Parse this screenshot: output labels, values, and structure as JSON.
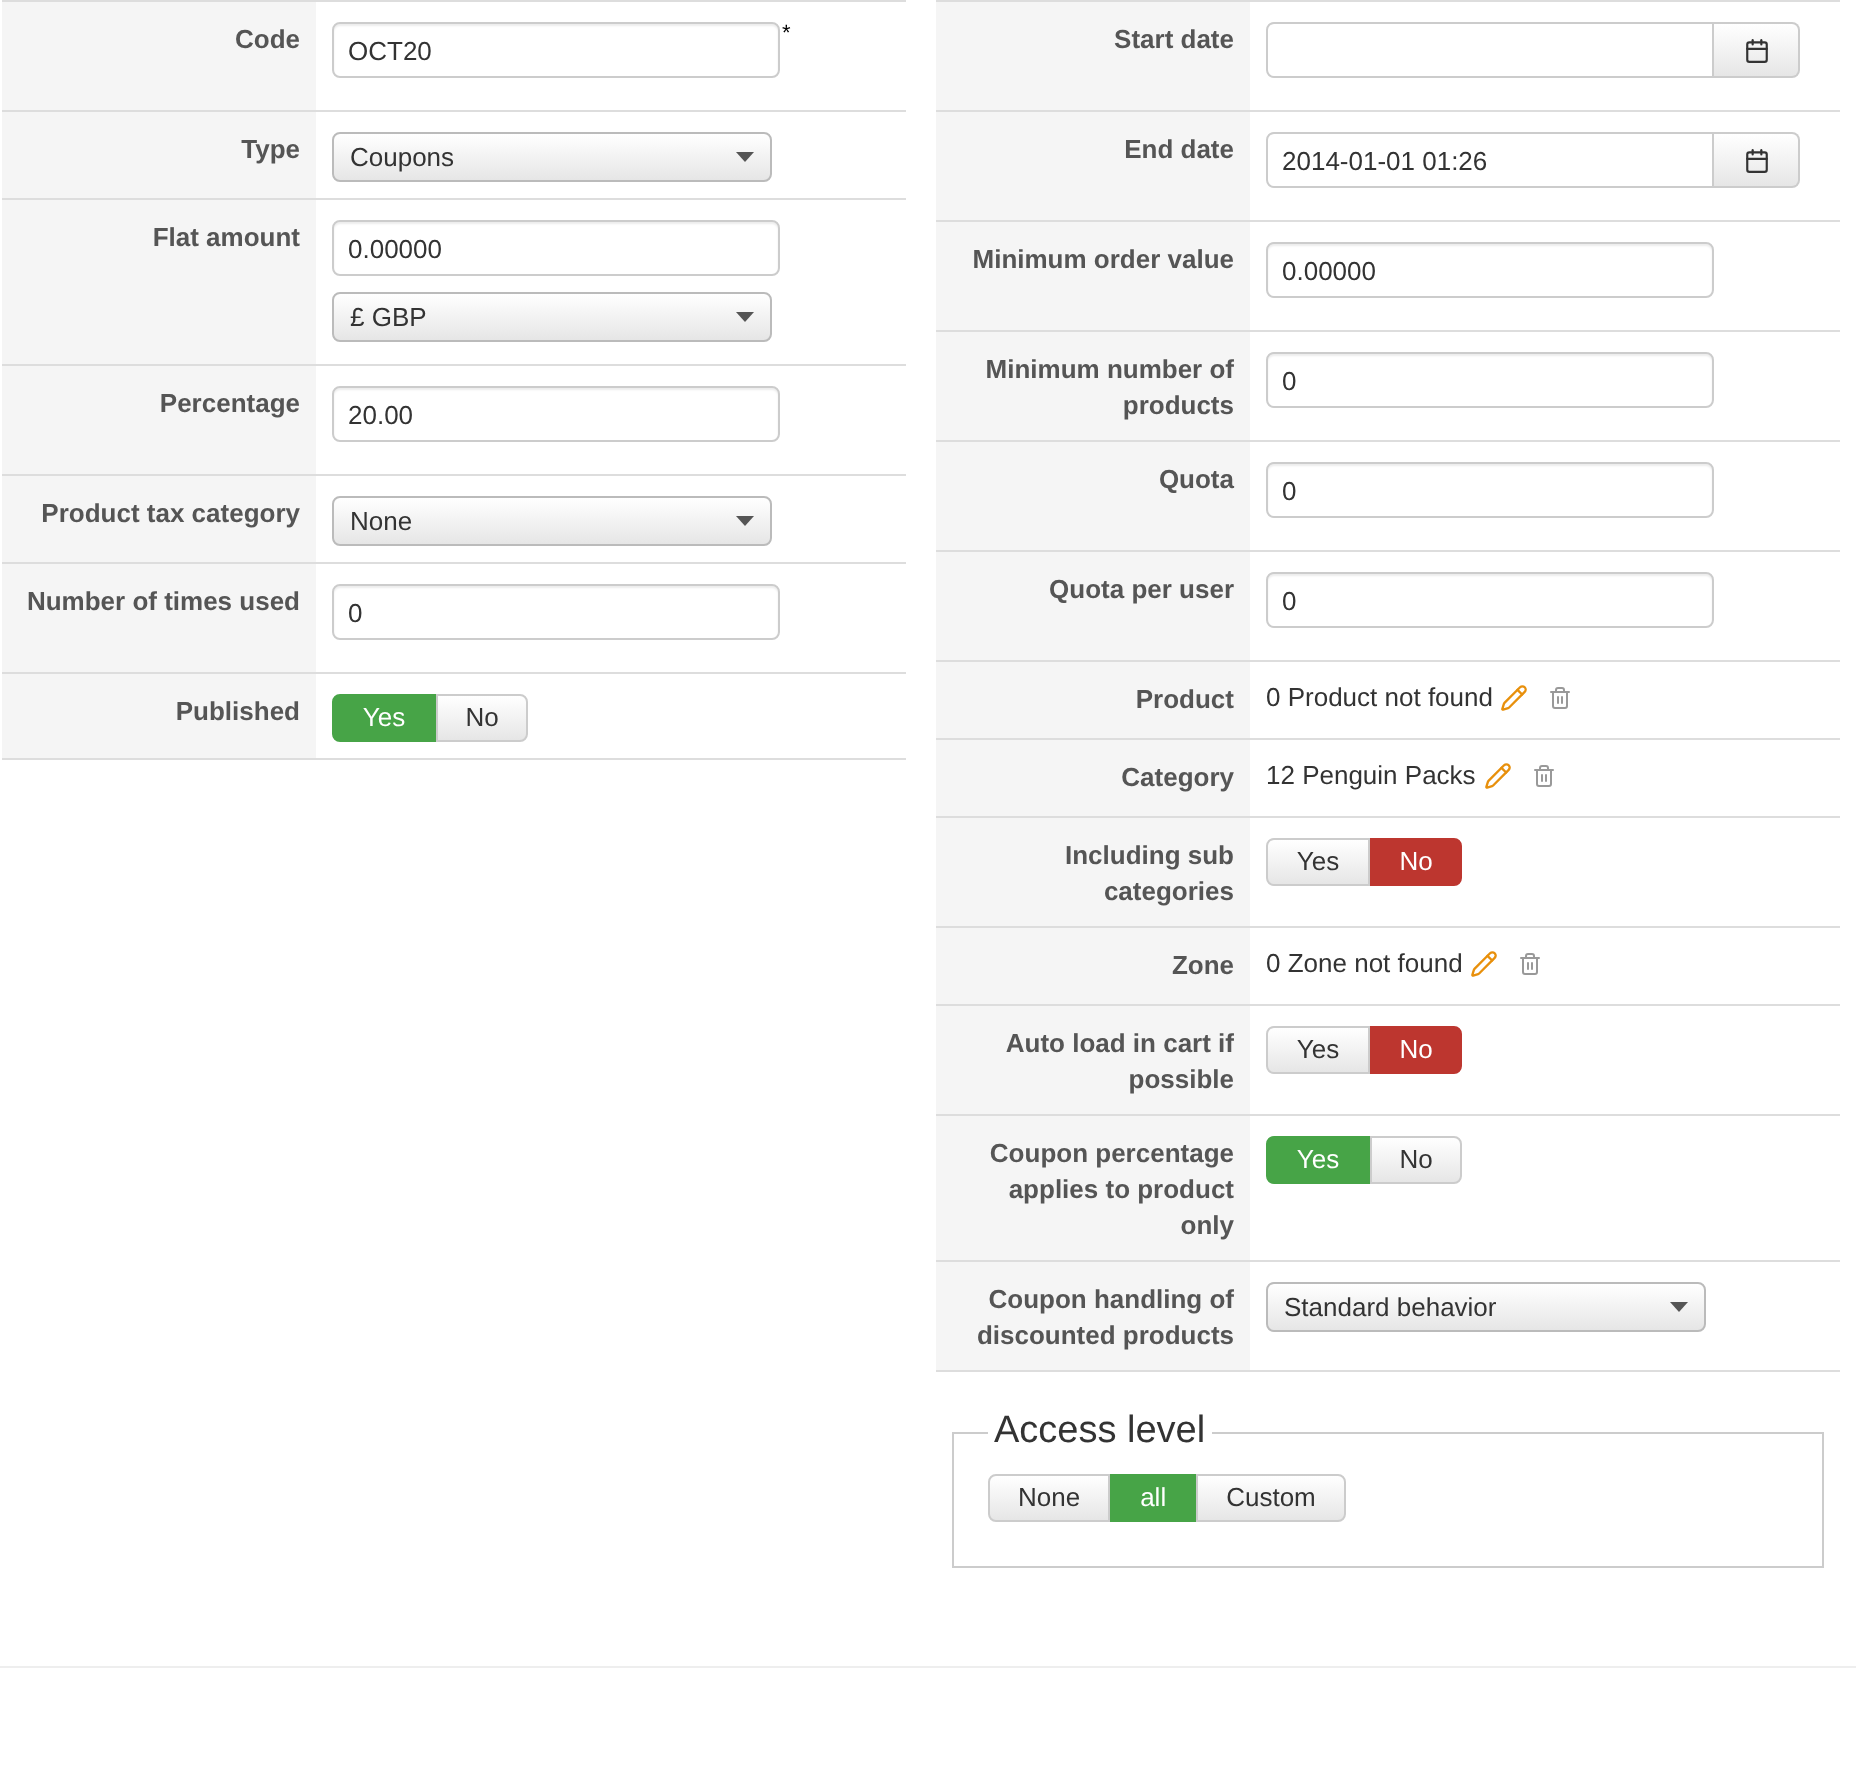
{
  "left_rows": [
    {
      "label": "Code",
      "kind": "text",
      "value": "OCT20",
      "required_mark": "*"
    },
    {
      "label": "Type",
      "kind": "select",
      "value": "Coupons"
    },
    {
      "label": "Flat amount",
      "kind": "amount",
      "value": "0.00000",
      "currency": "£ GBP"
    },
    {
      "label": "Percentage",
      "kind": "text",
      "value": "20.00"
    },
    {
      "label": "Product tax category",
      "kind": "select",
      "value": "None"
    },
    {
      "label": "Number of times used",
      "kind": "text",
      "value": "0"
    },
    {
      "label": "Published",
      "kind": "toggle",
      "options": [
        {
          "label": "Yes",
          "selected": true
        },
        {
          "label": "No",
          "selected": false
        }
      ]
    }
  ],
  "right_rows": [
    {
      "label": "Start date",
      "kind": "date"
    },
    {
      "label": "End date",
      "kind": "date",
      "value": "2014-01-01 01:26"
    },
    {
      "label": "Minimum order value",
      "kind": "text",
      "value": "0.00000"
    },
    {
      "label": "Minimum number of products",
      "kind": "text",
      "value": "0"
    },
    {
      "label": "Quota",
      "kind": "text",
      "value": "0"
    },
    {
      "label": "Quota per user",
      "kind": "text",
      "value": "0"
    },
    {
      "label": "Product",
      "kind": "link",
      "value": "0 Product not found"
    },
    {
      "label": "Category",
      "kind": "link",
      "value": "12 Penguin Packs"
    },
    {
      "label": "Including sub categories",
      "kind": "toggle",
      "options": [
        {
          "label": "Yes",
          "selected": false
        },
        {
          "label": "No",
          "selected": true
        }
      ]
    },
    {
      "label": "Zone",
      "kind": "link",
      "value": "0 Zone not found"
    },
    {
      "label": "Auto load in cart if possible",
      "kind": "toggle",
      "options": [
        {
          "label": "Yes",
          "selected": false
        },
        {
          "label": "No",
          "selected": true
        }
      ]
    },
    {
      "label": "Coupon percentage applies to product only",
      "kind": "toggle",
      "options": [
        {
          "label": "Yes",
          "selected": true
        },
        {
          "label": "No",
          "selected": false
        }
      ]
    },
    {
      "label": "Coupon handling of discounted products",
      "kind": "select",
      "value": "Standard behavior"
    }
  ],
  "access_level": {
    "legend": "Access level",
    "options": [
      {
        "label": "None",
        "selected": false
      },
      {
        "label": "all",
        "selected": true
      },
      {
        "label": "Custom",
        "selected": false
      }
    ]
  }
}
